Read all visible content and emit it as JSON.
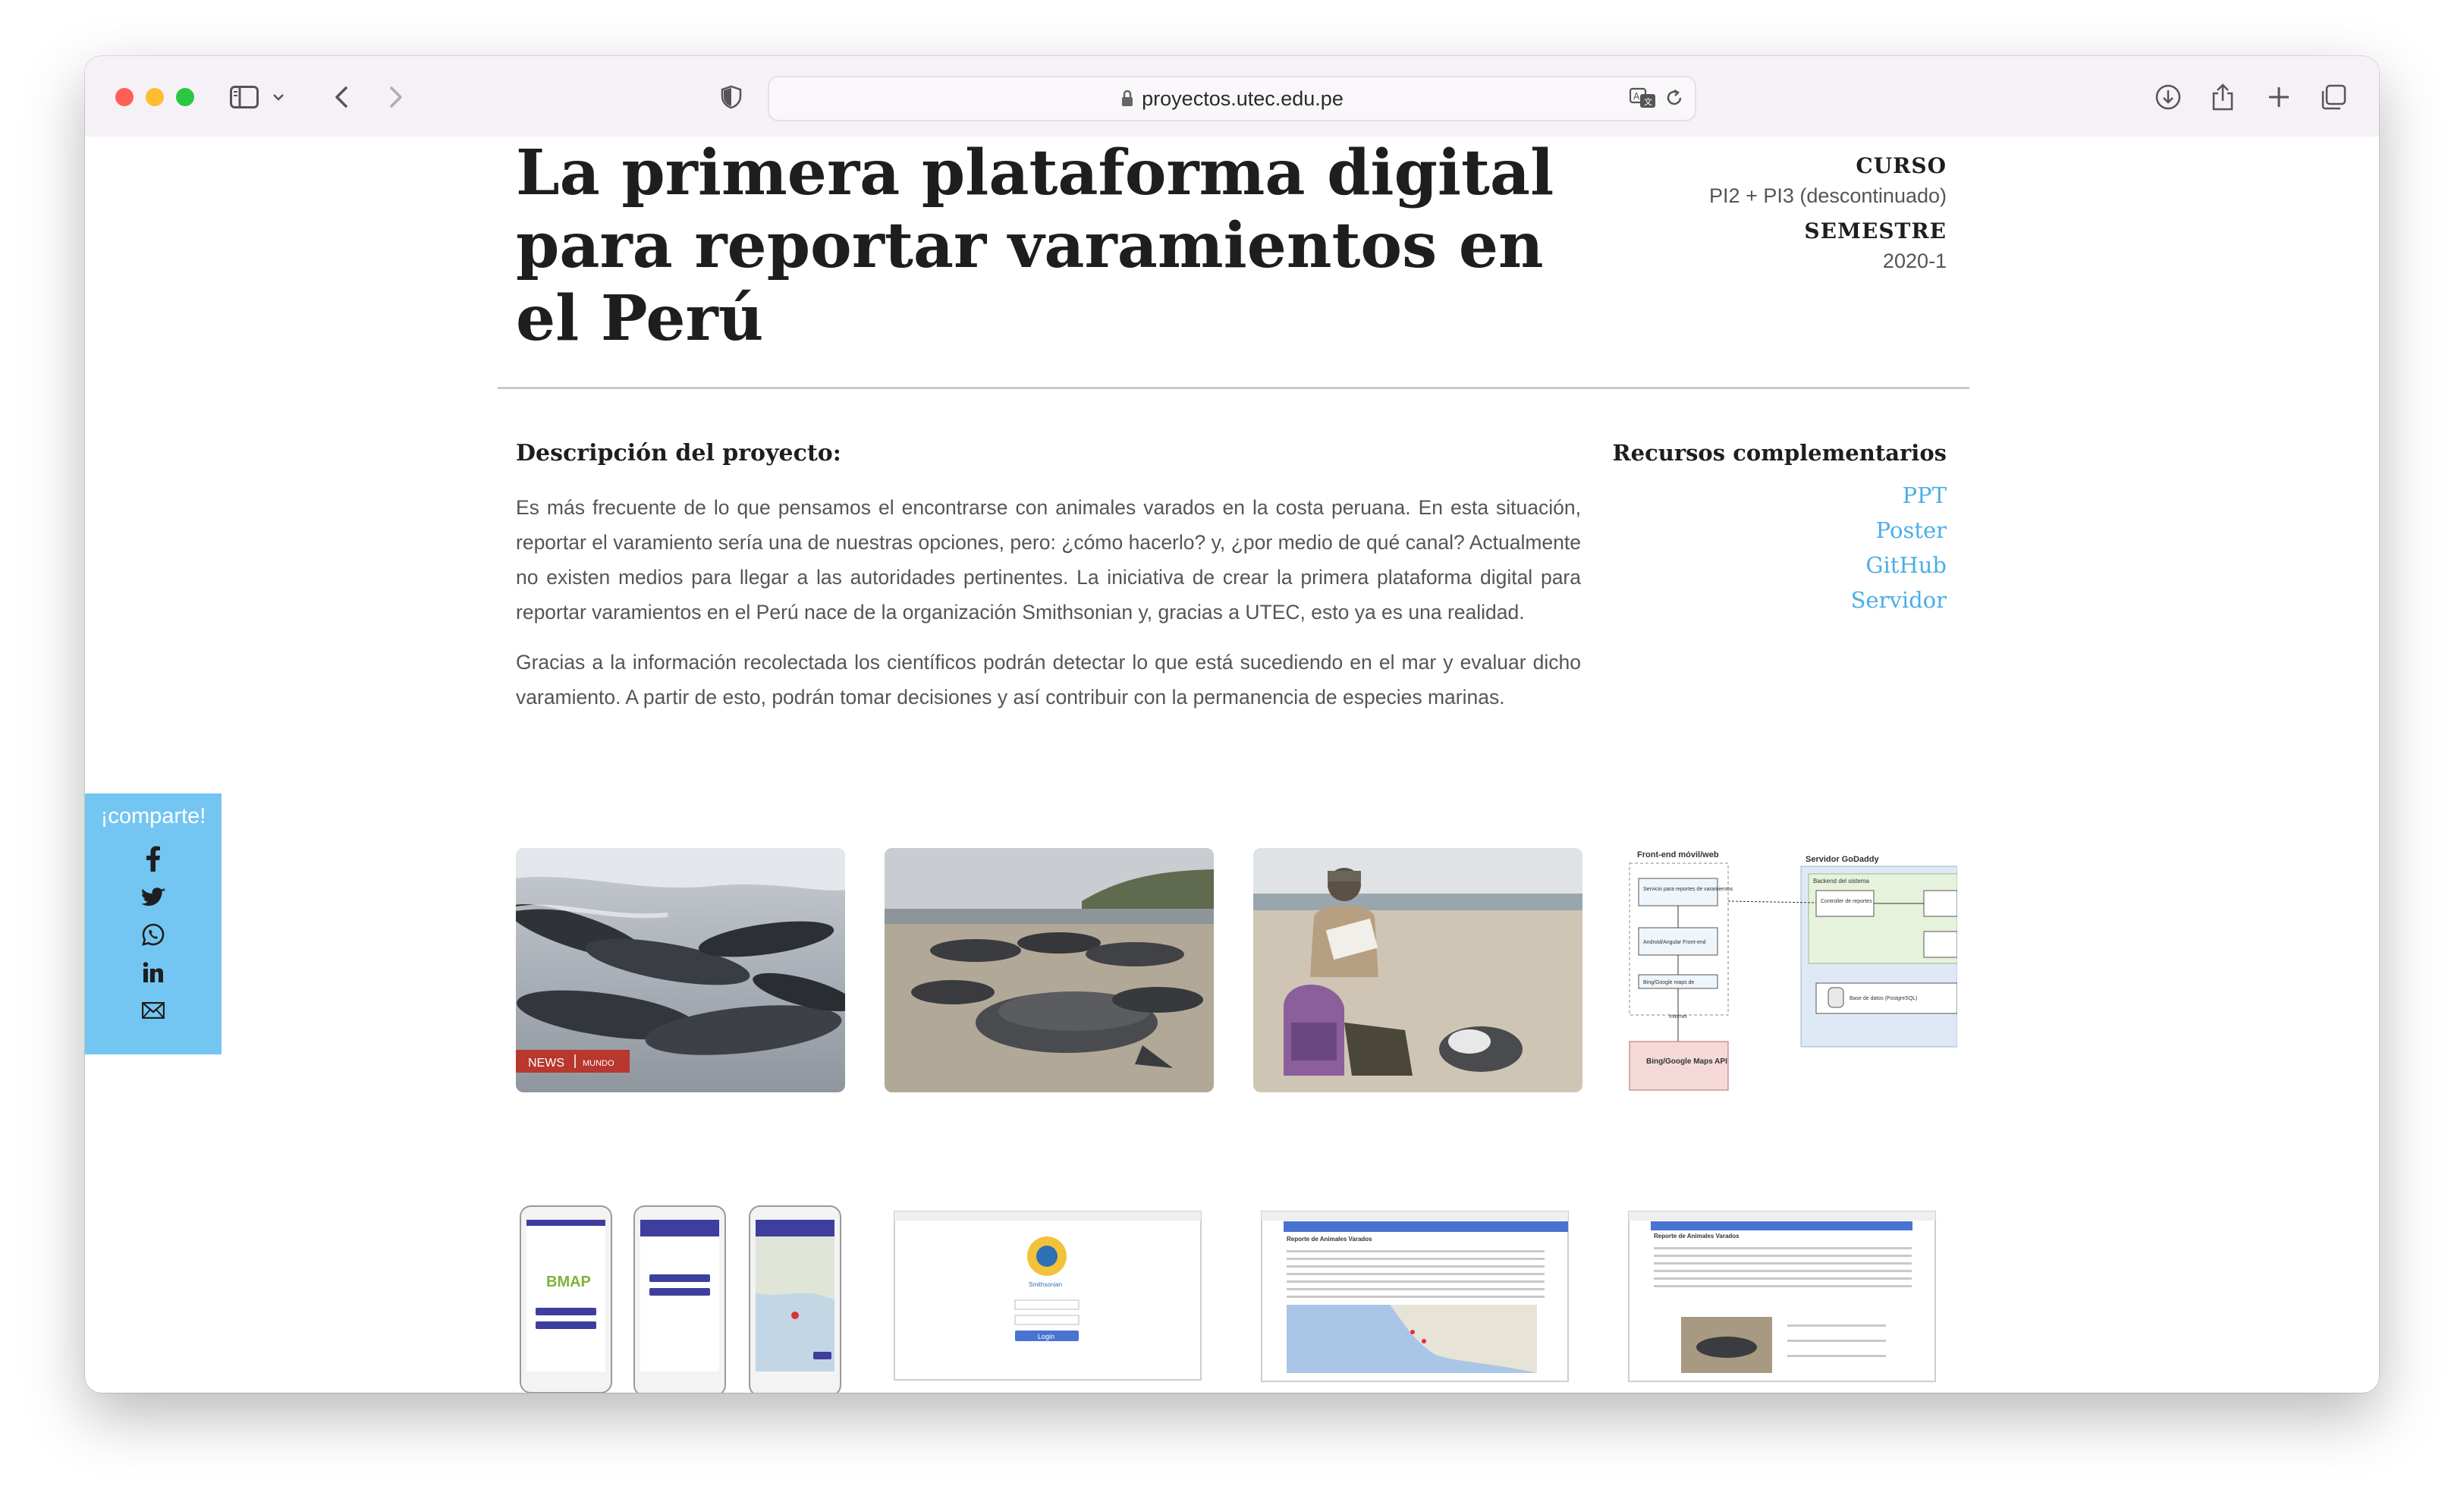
{
  "browser": {
    "url": "proyectos.utec.edu.pe"
  },
  "page": {
    "title": "La primera plataforma digital para reportar varamientos en el Perú",
    "curso_label": "CURSO",
    "curso_value": "PI2 + PI3 (descontinuado)",
    "semestre_label": "SEMESTRE",
    "semestre_value": "2020-1"
  },
  "description": {
    "heading": "Descripción del proyecto:",
    "paragraph1": "Es más frecuente de lo que pensamos el encontrarse con animales varados en la costa peruana. En esta situación, reportar el varamiento sería una de nuestras opciones, pero: ¿cómo hacerlo? y, ¿por medio de qué canal? Actualmente no existen medios para llegar a las autoridades pertinentes. La iniciativa de crear la primera plataforma digital para reportar varamientos en el Perú nace de la organización Smithsonian y, gracias a UTEC, esto ya es una realidad.",
    "paragraph2": "Gracias a la información recolectada los científicos podrán detectar lo que está sucediendo en el mar y evaluar dicho varamiento. A partir de esto, podrán tomar decisiones y así contribuir con la permanencia de especies marinas."
  },
  "resources": {
    "heading": "Recursos complementarios",
    "links": [
      "PPT",
      "Poster",
      "GitHub",
      "Servidor"
    ]
  },
  "share": {
    "label": "¡comparte!",
    "icons": [
      "facebook-icon",
      "twitter-icon",
      "whatsapp-icon",
      "linkedin-icon",
      "mail-icon"
    ]
  },
  "gallery": {
    "news_badge_main": "NEWS",
    "news_badge_sub": "MUNDO",
    "diagram": {
      "frontend_label": "Front-end móvil/web",
      "server_label": "Servidor GoDaddy",
      "backend_label": "Backend del sistema",
      "box1": "Servicio para reportes de varamientos",
      "box2": "Android/Angular Front-end",
      "box3": "Bing/Google maps de",
      "box4": "Controller de reportes",
      "box5": "Base de datos (PostgreSQL)",
      "internet_label": "Internet",
      "api_box": "Bing/Google Maps API"
    },
    "phone_logo": "BMAP",
    "login_button": "Login",
    "smithsonian_label": "Smithsonian",
    "report_title": "Reporte de Animales Varados"
  }
}
